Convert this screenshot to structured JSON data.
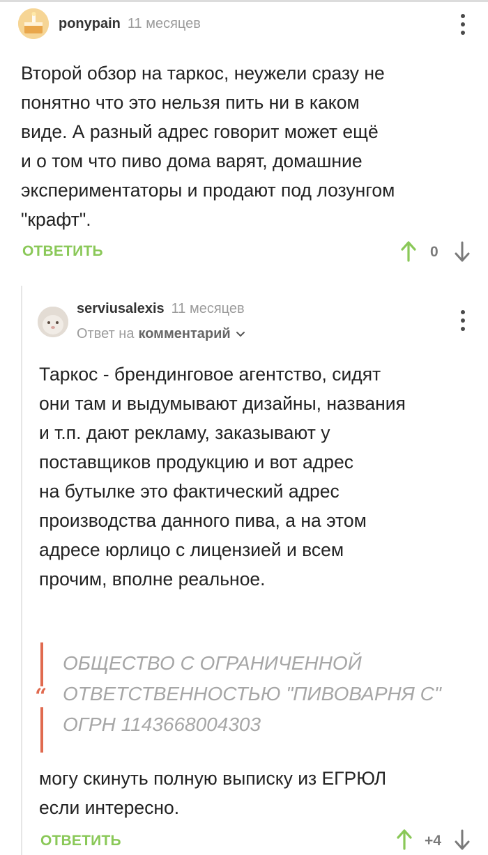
{
  "comments": [
    {
      "username": "ponypain",
      "time": "11 месяцев",
      "text_lines": [
        "Второй обзор на таркос, неужели сразу не",
        "понятно что это нельзя пить ни в каком",
        "виде. А разный адрес говорит может ещё",
        "и о том что пиво дома варят, домашние",
        "экспериментаторы и продают под лозунгом",
        "\"крафт\"."
      ],
      "reply_label": "ОТВЕТИТЬ",
      "score": "0"
    },
    {
      "username": "serviusalexis",
      "time": "11 месяцев",
      "answer_prefix": "Ответ на",
      "answer_target": "комментарий",
      "text_lines": [
        "Таркос - брендинговое агентство, сидят",
        "они там и выдумывают дизайны, названия",
        "и т.п. дают рекламу, заказывают у",
        "поставщиков продукцию и вот адрес",
        "на бутылке это фактический адрес",
        "производства данного пива, а на этом",
        "адресе юрлицо с лицензией и всем",
        "прочим, вполне реальное."
      ],
      "quote_lines": [
        "ОБЩЕСТВО С ОГРАНИЧЕННОЙ",
        "ОТВЕТСТВЕННОСТЬЮ \"ПИВОВАРНЯ С\"",
        "ОГРН 1143668004303"
      ],
      "after_quote_lines": [
        "могу скинуть полную выписку из ЕГРЮЛ",
        "если интересно."
      ],
      "reply_label": "ОТВЕТИТЬ",
      "score": "+4"
    }
  ],
  "colors": {
    "reply_green": "#8ac858",
    "quote_red": "#e06a4f"
  }
}
